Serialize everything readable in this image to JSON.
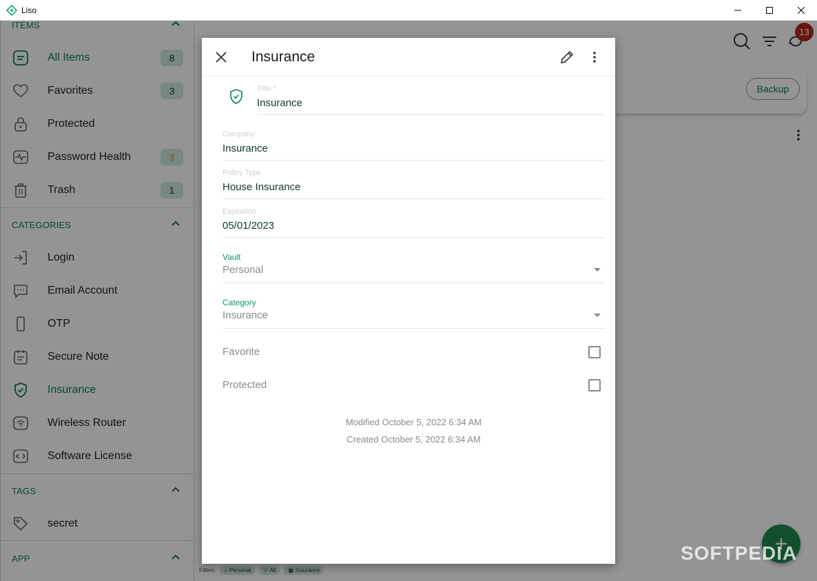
{
  "window": {
    "title": "Liso"
  },
  "sidebar": {
    "sections": [
      {
        "title": "ITEMS"
      },
      {
        "title": "CATEGORIES"
      },
      {
        "title": "TAGS"
      },
      {
        "title": "APP"
      }
    ],
    "items": [
      {
        "label": "All Items",
        "badge": "8",
        "icon": "list-icon",
        "active": true
      },
      {
        "label": "Favorites",
        "badge": "3",
        "icon": "heart-icon"
      },
      {
        "label": "Protected",
        "icon": "lock-icon"
      },
      {
        "label": "Password Health",
        "badge": "3",
        "icon": "health-icon"
      },
      {
        "label": "Trash",
        "badge": "1",
        "icon": "trash-icon"
      }
    ],
    "categories": [
      {
        "label": "Login",
        "icon": "login-icon"
      },
      {
        "label": "Email Account",
        "icon": "chat-icon"
      },
      {
        "label": "OTP",
        "icon": "phone-icon"
      },
      {
        "label": "Secure Note",
        "icon": "note-icon"
      },
      {
        "label": "Insurance",
        "icon": "shield-icon",
        "active": true
      },
      {
        "label": "Wireless Router",
        "icon": "router-icon"
      },
      {
        "label": "Software License",
        "icon": "code-icon"
      }
    ],
    "tags": [
      {
        "label": "secret",
        "icon": "tag-icon"
      }
    ]
  },
  "main": {
    "notification_count": "13",
    "backup_label": "Backup",
    "filters": {
      "label": "Filters:",
      "chips": [
        "Personal",
        "All",
        "Insurance"
      ]
    }
  },
  "dialog": {
    "title": "Insurance",
    "fields": {
      "title": {
        "label": "Title *",
        "value": "Insurance"
      },
      "company": {
        "label": "Company",
        "value": "Insurance"
      },
      "policy_type": {
        "label": "Policy Type",
        "value": "House Insurance"
      },
      "expiration": {
        "label": "Expiration",
        "value": "05/01/2023"
      },
      "vault": {
        "label": "Vault",
        "value": "Personal"
      },
      "category": {
        "label": "Category",
        "value": "Insurance"
      }
    },
    "favorite_label": "Favorite",
    "favorite_checked": false,
    "protected_label": "Protected",
    "protected_checked": false,
    "modified": "Modified October 5, 2022 6:34 AM",
    "created": "Created October 5, 2022 6:34 AM"
  },
  "watermark": "SOFTPEDIA",
  "colors": {
    "accent": "#0a7c55",
    "badge_bg": "#cfe9dc",
    "danger": "#b3261e",
    "fab": "#1f8a4c"
  }
}
